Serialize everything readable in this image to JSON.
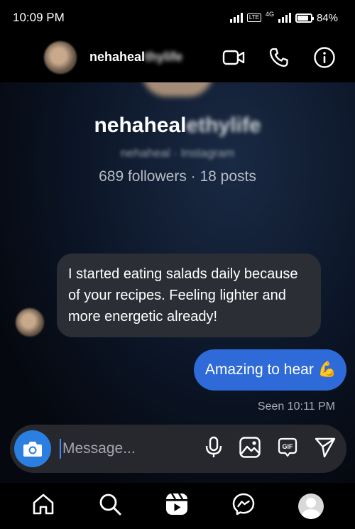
{
  "status": {
    "time": "10:09 PM",
    "battery": "84%",
    "net": "4G",
    "lte": "LTE"
  },
  "header": {
    "name_visible": "nehaheal",
    "name_blurred": "thylife"
  },
  "profile": {
    "name_visible": "nehaheal",
    "name_blurred": "ethylife",
    "subtitle": "nehaheal · Instagram",
    "stats": "689 followers · 18 posts"
  },
  "messages": {
    "incoming": "I started eating salads daily because of your recipes. Feeling lighter and more energetic already!",
    "outgoing": "Amazing to hear",
    "outgoing_emoji": "💪",
    "seen": "Seen 10:11 PM"
  },
  "composer": {
    "placeholder": "Message..."
  },
  "icons": {
    "header": [
      "video-call-icon",
      "phone-call-icon",
      "info-icon"
    ],
    "composer": [
      "camera-icon",
      "microphone-icon",
      "gallery-icon",
      "gif-icon",
      "send-icon"
    ],
    "nav": [
      "home-icon",
      "search-icon",
      "reels-icon",
      "messenger-icon",
      "profile-avatar"
    ]
  },
  "colors": {
    "accent": "#2f6bd8",
    "camera_button": "#2a7fe0",
    "incoming_bubble": "#2b2e35"
  }
}
